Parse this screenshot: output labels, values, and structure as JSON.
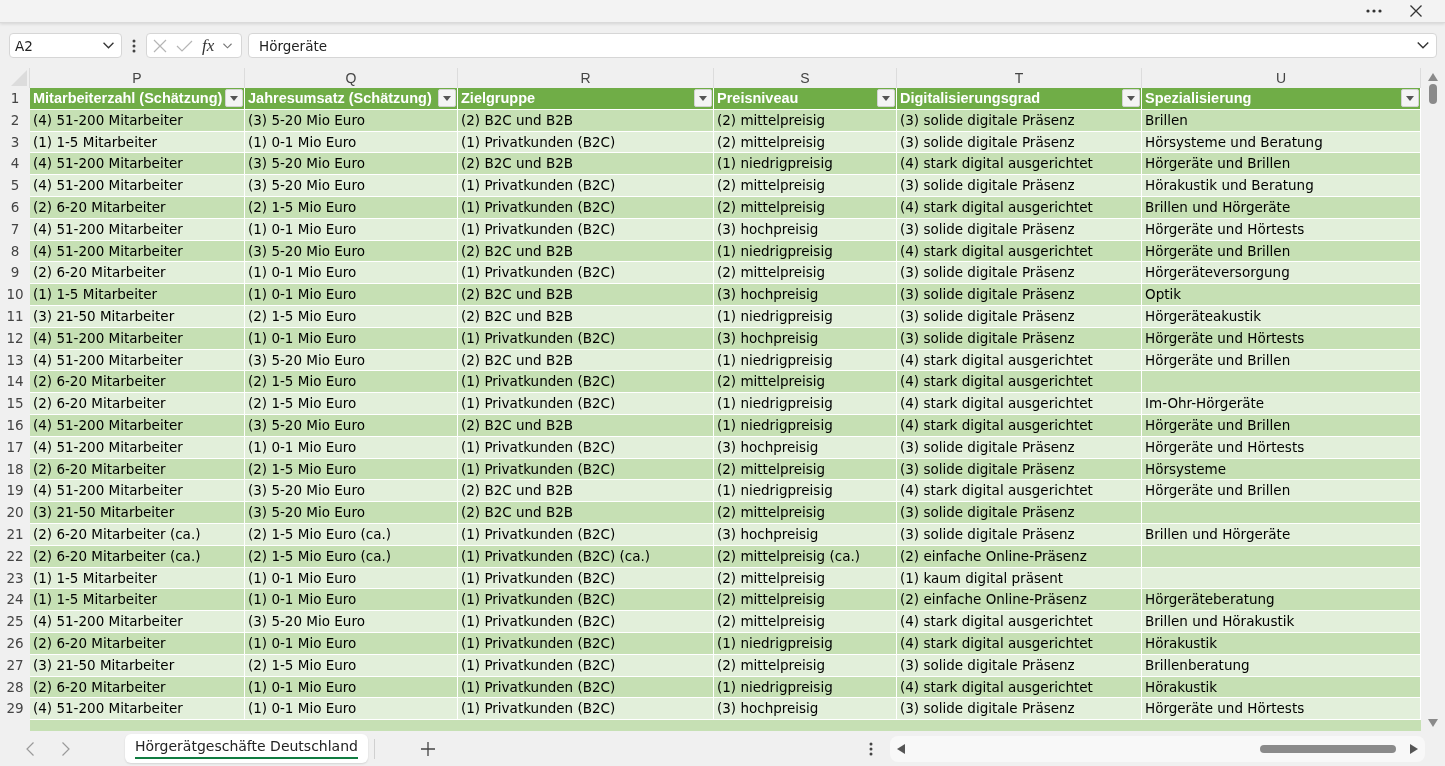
{
  "formula_bar": {
    "name_box": "A2",
    "function_button": "fx",
    "formula": "Hörgeräte"
  },
  "header_row_number": "1",
  "columns": [
    {
      "letter": "P",
      "header": "Mitarbeiterzahl (Schätzung)"
    },
    {
      "letter": "Q",
      "header": "Jahresumsatz (Schätzung)"
    },
    {
      "letter": "R",
      "header": "Zielgruppe"
    },
    {
      "letter": "S",
      "header": "Preisniveau"
    },
    {
      "letter": "T",
      "header": "Digitalisierungsgrad"
    },
    {
      "letter": "U",
      "header": "Spezialisierung"
    }
  ],
  "rows": [
    {
      "number": "2",
      "cells": [
        "(4) 51-200 Mitarbeiter",
        "(3) 5-20 Mio Euro",
        "(2) B2C und B2B",
        "(2) mittelpreisig",
        "(3) solide digitale Präsenz",
        "Brillen"
      ]
    },
    {
      "number": "3",
      "cells": [
        "(1) 1-5 Mitarbeiter",
        "(1) 0-1 Mio Euro",
        "(1) Privatkunden (B2C)",
        "(2) mittelpreisig",
        "(3) solide digitale Präsenz",
        "Hörsysteme und Beratung"
      ]
    },
    {
      "number": "4",
      "cells": [
        "(4) 51-200 Mitarbeiter",
        "(3) 5-20 Mio Euro",
        "(2) B2C und B2B",
        "(1) niedrigpreisig",
        "(4) stark digital ausgerichtet",
        "Hörgeräte und Brillen"
      ]
    },
    {
      "number": "5",
      "cells": [
        "(4) 51-200 Mitarbeiter",
        "(3) 5-20 Mio Euro",
        "(1) Privatkunden (B2C)",
        "(2) mittelpreisig",
        "(3) solide digitale Präsenz",
        "Hörakustik und Beratung"
      ]
    },
    {
      "number": "6",
      "cells": [
        "(2) 6-20 Mitarbeiter",
        "(2) 1-5 Mio Euro",
        "(1) Privatkunden (B2C)",
        "(2) mittelpreisig",
        "(4) stark digital ausgerichtet",
        "Brillen und Hörgeräte"
      ]
    },
    {
      "number": "7",
      "cells": [
        "(4) 51-200 Mitarbeiter",
        "(1) 0-1 Mio Euro",
        "(1) Privatkunden (B2C)",
        "(3) hochpreisig",
        "(3) solide digitale Präsenz",
        "Hörgeräte und Hörtests"
      ]
    },
    {
      "number": "8",
      "cells": [
        "(4) 51-200 Mitarbeiter",
        "(3) 5-20 Mio Euro",
        "(2) B2C und B2B",
        "(1) niedrigpreisig",
        "(4) stark digital ausgerichtet",
        "Hörgeräte und Brillen"
      ]
    },
    {
      "number": "9",
      "cells": [
        "(2) 6-20 Mitarbeiter",
        "(1) 0-1 Mio Euro",
        "(1) Privatkunden (B2C)",
        "(2) mittelpreisig",
        "(3) solide digitale Präsenz",
        "Hörgeräteversorgung"
      ]
    },
    {
      "number": "10",
      "cells": [
        "(1) 1-5 Mitarbeiter",
        "(1) 0-1 Mio Euro",
        "(2) B2C und B2B",
        "(3) hochpreisig",
        "(3) solide digitale Präsenz",
        "Optik"
      ]
    },
    {
      "number": "11",
      "cells": [
        "(3) 21-50 Mitarbeiter",
        "(2) 1-5 Mio Euro",
        "(2) B2C und B2B",
        "(1) niedrigpreisig",
        "(3) solide digitale Präsenz",
        "Hörgeräteakustik"
      ]
    },
    {
      "number": "12",
      "cells": [
        "(4) 51-200 Mitarbeiter",
        "(1) 0-1 Mio Euro",
        "(1) Privatkunden (B2C)",
        "(3) hochpreisig",
        "(3) solide digitale Präsenz",
        "Hörgeräte und Hörtests"
      ]
    },
    {
      "number": "13",
      "cells": [
        "(4) 51-200 Mitarbeiter",
        "(3) 5-20 Mio Euro",
        "(2) B2C und B2B",
        "(1) niedrigpreisig",
        "(4) stark digital ausgerichtet",
        "Hörgeräte und Brillen"
      ]
    },
    {
      "number": "14",
      "cells": [
        "(2) 6-20 Mitarbeiter",
        "(2) 1-5 Mio Euro",
        "(1) Privatkunden (B2C)",
        "(2) mittelpreisig",
        "(4) stark digital ausgerichtet"
      ]
    },
    {
      "number": "15",
      "cells": [
        "(2) 6-20 Mitarbeiter",
        "(2) 1-5 Mio Euro",
        "(1) Privatkunden (B2C)",
        "(1) niedrigpreisig",
        "(4) stark digital ausgerichtet",
        "Im-Ohr-Hörgeräte"
      ]
    },
    {
      "number": "16",
      "cells": [
        "(4) 51-200 Mitarbeiter",
        "(3) 5-20 Mio Euro",
        "(2) B2C und B2B",
        "(1) niedrigpreisig",
        "(4) stark digital ausgerichtet",
        "Hörgeräte und Brillen"
      ]
    },
    {
      "number": "17",
      "cells": [
        "(4) 51-200 Mitarbeiter",
        "(1) 0-1 Mio Euro",
        "(1) Privatkunden (B2C)",
        "(3) hochpreisig",
        "(3) solide digitale Präsenz",
        "Hörgeräte und Hörtests"
      ]
    },
    {
      "number": "18",
      "cells": [
        "(2) 6-20 Mitarbeiter",
        "(2) 1-5 Mio Euro",
        "(1) Privatkunden (B2C)",
        "(2) mittelpreisig",
        "(3) solide digitale Präsenz",
        "Hörsysteme"
      ]
    },
    {
      "number": "19",
      "cells": [
        "(4) 51-200 Mitarbeiter",
        "(3) 5-20 Mio Euro",
        "(2) B2C und B2B",
        "(1) niedrigpreisig",
        "(4) stark digital ausgerichtet",
        "Hörgeräte und Brillen"
      ]
    },
    {
      "number": "20",
      "cells": [
        "(3) 21-50 Mitarbeiter",
        "(3) 5-20 Mio Euro",
        "(2) B2C und B2B",
        "(2) mittelpreisig",
        "(3) solide digitale Präsenz"
      ]
    },
    {
      "number": "21",
      "cells": [
        "(2) 6-20 Mitarbeiter (ca.)",
        "(2) 1-5 Mio Euro (ca.)",
        "(1) Privatkunden (B2C)",
        "(3) hochpreisig",
        "(3) solide digitale Präsenz",
        "Brillen und Hörgeräte"
      ]
    },
    {
      "number": "22",
      "cells": [
        "(2) 6-20 Mitarbeiter (ca.)",
        "(2) 1-5 Mio Euro (ca.)",
        "(1) Privatkunden (B2C) (ca.)",
        "(2) mittelpreisig (ca.)",
        "(2) einfache Online-Präsenz"
      ]
    },
    {
      "number": "23",
      "cells": [
        "(1) 1-5 Mitarbeiter",
        "(1) 0-1 Mio Euro",
        "(1) Privatkunden (B2C)",
        "(2) mittelpreisig",
        "(1) kaum digital präsent"
      ]
    },
    {
      "number": "24",
      "cells": [
        "(1) 1-5 Mitarbeiter",
        "(1) 0-1 Mio Euro",
        "(1) Privatkunden (B2C)",
        "(2) mittelpreisig",
        "(2) einfache Online-Präsenz",
        "Hörgeräteberatung"
      ]
    },
    {
      "number": "25",
      "cells": [
        "(4) 51-200 Mitarbeiter",
        "(3) 5-20 Mio Euro",
        "(1) Privatkunden (B2C)",
        "(2) mittelpreisig",
        "(4) stark digital ausgerichtet",
        "Brillen und Hörakustik"
      ]
    },
    {
      "number": "26",
      "cells": [
        "(2) 6-20 Mitarbeiter",
        "(1) 0-1 Mio Euro",
        "(1) Privatkunden (B2C)",
        "(1) niedrigpreisig",
        "(4) stark digital ausgerichtet",
        "Hörakustik"
      ]
    },
    {
      "number": "27",
      "cells": [
        "(3) 21-50 Mitarbeiter",
        "(2) 1-5 Mio Euro",
        "(1) Privatkunden (B2C)",
        "(2) mittelpreisig",
        "(3) solide digitale Präsenz",
        "Brillenberatung"
      ]
    },
    {
      "number": "28",
      "cells": [
        "(2) 6-20 Mitarbeiter",
        "(1) 0-1 Mio Euro",
        "(1) Privatkunden (B2C)",
        "(1) niedrigpreisig",
        "(4) stark digital ausgerichtet",
        "Hörakustik"
      ]
    },
    {
      "number": "29",
      "cells": [
        "(4) 51-200 Mitarbeiter",
        "(1) 0-1 Mio Euro",
        "(1) Privatkunden (B2C)",
        "(3) hochpreisig",
        "(3) solide digitale Präsenz",
        "Hörgeräte und Hörtests"
      ]
    }
  ],
  "sheet_tabs": [
    {
      "label": "Hörgerätgeschäfte Deutschland",
      "selected": true
    }
  ]
}
